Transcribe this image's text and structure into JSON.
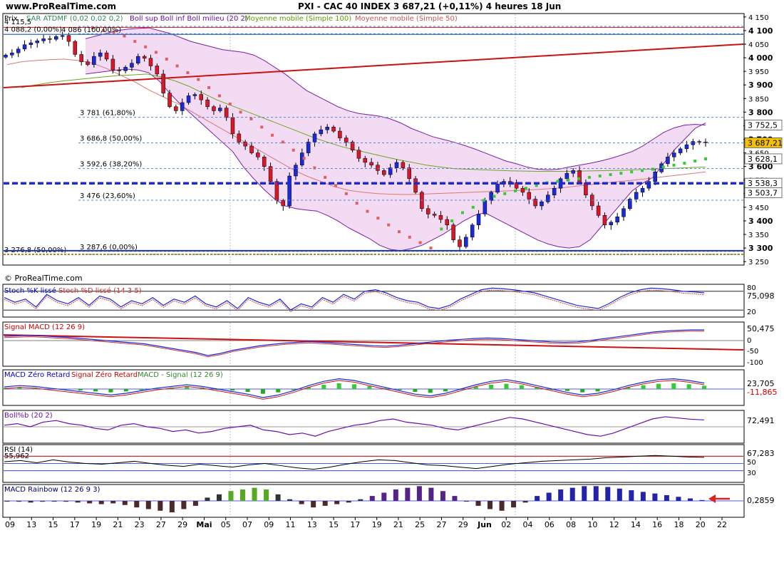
{
  "header": {
    "site": "www.ProRealTime.com",
    "title": "PXI - CAC 40 INDEX    3 687,21 (+0,11%)    4 heures  18 Jun"
  },
  "main": {
    "legend_prix": "Prix",
    "legend_sar": "SAR ATDMF (0,02 0,02 0,2)",
    "legend_boll": "Boll sup Boll inf Boll milieu (20 2)",
    "legend_ma100": "Moyenne mobile (Simple 100)",
    "legend_ma50": "Moyenne mobile (Simple 50)",
    "copyright": "© ProRealTime.com",
    "fib": [
      {
        "label": "4 115,5",
        "value": 4115.5
      },
      {
        "label": "4 088,2 (0,00%)",
        "value": 4088.2
      },
      {
        "label": "4 086 (100,00%)",
        "value": 4086
      },
      {
        "label": "3 781 (61,80%)",
        "value": 3781
      },
      {
        "label": "3 686,8 (50,00%)",
        "value": 3686.8
      },
      {
        "label": "3 592,6 (38,20%)",
        "value": 3592.6
      },
      {
        "label": "3 476 (23,60%)",
        "value": 3476
      },
      {
        "label": "3 287,6 (0,00%)",
        "value": 3287.6
      },
      {
        "label": "3 276,8 (50,00%)",
        "value": 3276.8
      }
    ],
    "yticks": [
      "4 150",
      "4 100",
      "4 050",
      "4 000",
      "3 950",
      "3 900",
      "3 850",
      "3 800",
      "3 750",
      "3 700",
      "3 650",
      "3 600",
      "3 550",
      "3 500",
      "3 450",
      "3 400",
      "3 350",
      "3 300",
      "3 250"
    ],
    "badges": [
      {
        "label": "3 752,5",
        "value": 3752.5,
        "bg": "#ffffff",
        "fg": "#000000"
      },
      {
        "label": "3 687,21",
        "value": 3687.21,
        "bg": "#f4c200",
        "fg": "#000000"
      },
      {
        "label": "3 628,1",
        "value": 3628.1,
        "bg": "#ffffff",
        "fg": "#000000"
      },
      {
        "label": "3 538,3",
        "value": 3538.3,
        "bg": "#ffffff",
        "fg": "#000000"
      },
      {
        "label": "3 503,7",
        "value": 3503.7,
        "bg": "#ffffff",
        "fg": "#000000"
      }
    ]
  },
  "panels": {
    "stoch": {
      "label_k": "Stoch %K lissé",
      "label_d": "Stoch %D lissé (14 3 5)",
      "value": "75,098",
      "ticks": [
        "80",
        "20"
      ]
    },
    "macd": {
      "label": "Signal MACD (12 26 9)",
      "value": "50,475",
      "ticks": [
        "0",
        "-50",
        "-100"
      ]
    },
    "macdzr": {
      "label_a": "MACD Zéro Retard",
      "label_b": "Signal Zéro Retard",
      "label_c": "MACD - Signal (12 26 9)",
      "value": "23,705",
      "value2": "-11,865"
    },
    "bollb": {
      "label": "Boll%b (20 2)",
      "value": "72,491"
    },
    "rsi": {
      "label": "RSI (14)",
      "top_value": "55,962",
      "value": "67,283",
      "ticks": [
        "50",
        "30"
      ]
    },
    "rainbow": {
      "label": "MACD Rainbow (12 26 9 3)",
      "value": "0,2859"
    }
  },
  "chart_data": {
    "type": "candlestick",
    "title": "PXI - CAC 40 INDEX",
    "timeframe": "4 heures",
    "last": 3687.21,
    "change": "+0,11%",
    "ylim": [
      3240,
      4160
    ],
    "x_ticks": [
      "09",
      "13",
      "15",
      "17",
      "19",
      "21",
      "23",
      "27",
      "29",
      "Mai",
      "05",
      "07",
      "09",
      "11",
      "13",
      "15",
      "17",
      "19",
      "21",
      "25",
      "27",
      "29",
      "Jun",
      "02",
      "04",
      "06",
      "08",
      "10",
      "12",
      "14",
      "16",
      "18",
      "20",
      "22"
    ],
    "close": [
      4010,
      4018,
      4032,
      4048,
      4055,
      4062,
      4070,
      4068,
      4078,
      4082,
      4060,
      4012,
      3985,
      3975,
      4005,
      4018,
      3995,
      3955,
      3952,
      3965,
      3980,
      4005,
      3998,
      3970,
      3940,
      3870,
      3820,
      3805,
      3835,
      3860,
      3865,
      3845,
      3820,
      3805,
      3815,
      3780,
      3720,
      3690,
      3675,
      3650,
      3635,
      3600,
      3545,
      3475,
      3455,
      3565,
      3605,
      3650,
      3690,
      3720,
      3735,
      3745,
      3730,
      3705,
      3690,
      3660,
      3630,
      3615,
      3605,
      3585,
      3570,
      3595,
      3615,
      3595,
      3555,
      3505,
      3445,
      3425,
      3420,
      3405,
      3385,
      3330,
      3305,
      3340,
      3385,
      3425,
      3475,
      3505,
      3535,
      3545,
      3540,
      3520,
      3505,
      3480,
      3455,
      3470,
      3495,
      3520,
      3555,
      3575,
      3585,
      3540,
      3495,
      3455,
      3420,
      3385,
      3395,
      3415,
      3445,
      3480,
      3505,
      3520,
      3545,
      3580,
      3610,
      3635,
      3650,
      3665,
      3680,
      3692,
      3690,
      3688
    ],
    "bollinger_upper": [
      4070,
      4080,
      4090,
      4100,
      4105,
      4108,
      4110,
      4100,
      4090,
      4075,
      4060,
      4050,
      4040,
      4030,
      4025,
      4020,
      4010,
      3990,
      3965,
      3940,
      3910,
      3880,
      3860,
      3840,
      3820,
      3805,
      3795,
      3790,
      3785,
      3775,
      3760,
      3740,
      3725,
      3710,
      3700,
      3690,
      3678,
      3665,
      3650,
      3635,
      3620,
      3610,
      3598,
      3590,
      3588,
      3590,
      3598,
      3605,
      3612,
      3620,
      3630,
      3642,
      3655,
      3675,
      3700,
      3725,
      3742,
      3752,
      3755,
      3752
    ],
    "bollinger_lower": [
      3940,
      3945,
      3950,
      3955,
      3958,
      3955,
      3945,
      3915,
      3870,
      3830,
      3795,
      3760,
      3725,
      3690,
      3655,
      3600,
      3555,
      3515,
      3480,
      3455,
      3445,
      3440,
      3436,
      3420,
      3400,
      3375,
      3355,
      3335,
      3310,
      3295,
      3290,
      3298,
      3310,
      3330,
      3350,
      3375,
      3400,
      3420,
      3430,
      3410,
      3390,
      3370,
      3350,
      3330,
      3315,
      3305,
      3300,
      3305,
      3330,
      3375,
      3420,
      3465,
      3510,
      3538,
      3560,
      3610,
      3660,
      3700,
      3740,
      3760
    ],
    "sar": [
      4110,
      4100,
      4095,
      4080,
      4060,
      4040,
      4020,
      3995,
      3970,
      3945,
      3920,
      3890,
      3860,
      3830,
      3800,
      3775,
      3745,
      3715,
      3690,
      3660,
      3630,
      3595,
      3560,
      3530,
      3500,
      3465,
      3435,
      3410,
      3385,
      3360,
      3340,
      3320,
      3300,
      3370,
      3400,
      3430,
      3450,
      3475,
      3490,
      3500,
      3510,
      3520,
      3530,
      3540,
      3545,
      3550,
      3555,
      3560,
      3565,
      3570,
      3575,
      3580,
      3585,
      3590,
      3598,
      3605,
      3612,
      3620,
      3628
    ],
    "ma100": [
      3890,
      3900,
      3908,
      3915,
      3920,
      3925,
      3930,
      3935,
      3937,
      3940,
      3930,
      3915,
      3895,
      3870,
      3845,
      3825,
      3805,
      3785,
      3765,
      3745,
      3725,
      3705,
      3688,
      3672,
      3660,
      3648,
      3636,
      3625,
      3615,
      3605,
      3598,
      3592,
      3590,
      3588,
      3586,
      3584,
      3583,
      3582,
      3582,
      3582,
      3583,
      3584,
      3585,
      3586,
      3588,
      3590,
      3592,
      3594,
      3596,
      3598
    ],
    "ma50": [
      3975,
      3985,
      3990,
      3993,
      3995,
      3990,
      3980,
      3960,
      3935,
      3910,
      3880,
      3855,
      3830,
      3800,
      3770,
      3740,
      3710,
      3680,
      3650,
      3620,
      3590,
      3565,
      3545,
      3525,
      3512,
      3505,
      3500,
      3498,
      3497,
      3498,
      3500,
      3502,
      3504,
      3506,
      3508,
      3510,
      3512,
      3515,
      3518,
      3522,
      3528,
      3534,
      3540,
      3545,
      3550,
      3556,
      3562,
      3568,
      3574,
      3580
    ],
    "stoch_k": [
      60,
      45,
      55,
      30,
      70,
      50,
      40,
      60,
      35,
      65,
      55,
      30,
      50,
      40,
      60,
      35,
      55,
      45,
      65,
      40,
      30,
      50,
      25,
      60,
      45,
      35,
      55,
      20,
      40,
      30,
      60,
      45,
      70,
      55,
      80,
      85,
      75,
      60,
      50,
      45,
      30,
      25,
      35,
      55,
      70,
      85,
      90,
      88,
      85,
      80,
      75,
      65,
      55,
      45,
      35,
      30,
      25,
      40,
      60,
      75,
      85,
      90,
      88,
      85,
      80,
      78,
      75
    ],
    "macd_signal": [
      20,
      22,
      24,
      22,
      18,
      15,
      10,
      5,
      0,
      -5,
      -10,
      -15,
      -25,
      -35,
      -45,
      -55,
      -70,
      -60,
      -45,
      -35,
      -25,
      -18,
      -12,
      -8,
      -5,
      -8,
      -12,
      -16,
      -20,
      -24,
      -26,
      -22,
      -16,
      -10,
      -4,
      2,
      6,
      10,
      12,
      10,
      6,
      2,
      -2,
      -6,
      -8,
      -6,
      0,
      8,
      16,
      24,
      32,
      40,
      45,
      48,
      50,
      50
    ],
    "macd_zero_retard": [
      5,
      8,
      6,
      2,
      -2,
      -6,
      -10,
      -14,
      -10,
      -4,
      2,
      6,
      10,
      6,
      0,
      -6,
      -12,
      -20,
      -14,
      -4,
      8,
      18,
      24,
      20,
      12,
      4,
      -4,
      -12,
      -16,
      -10,
      0,
      10,
      18,
      22,
      16,
      8,
      0,
      -8,
      -14,
      -10,
      -2,
      8,
      16,
      22,
      24,
      20,
      14
    ],
    "boll_b": [
      55,
      60,
      50,
      65,
      70,
      60,
      55,
      45,
      40,
      55,
      60,
      50,
      45,
      35,
      40,
      30,
      35,
      45,
      50,
      55,
      40,
      35,
      25,
      30,
      20,
      35,
      45,
      55,
      60,
      70,
      75,
      65,
      60,
      55,
      45,
      40,
      50,
      60,
      70,
      80,
      75,
      65,
      55,
      45,
      35,
      25,
      20,
      30,
      45,
      60,
      75,
      82,
      78,
      74,
      72
    ],
    "rsi": [
      55,
      58,
      52,
      60,
      54,
      50,
      48,
      52,
      56,
      50,
      45,
      42,
      48,
      44,
      40,
      46,
      50,
      44,
      38,
      34,
      40,
      48,
      55,
      60,
      58,
      52,
      46,
      44,
      40,
      36,
      42,
      48,
      52,
      56,
      58,
      60,
      62,
      66,
      68,
      70,
      72,
      70,
      68,
      67
    ],
    "macd_rainbow": [
      0,
      -1,
      -2,
      -1,
      0,
      -1,
      -2,
      -3,
      -4,
      -3,
      -5,
      -8,
      -10,
      -12,
      -14,
      -10,
      -6,
      4,
      8,
      12,
      14,
      16,
      14,
      8,
      2,
      -4,
      -8,
      -6,
      -4,
      -2,
      2,
      6,
      10,
      14,
      16,
      18,
      16,
      12,
      6,
      0,
      -6,
      -10,
      -12,
      -8,
      -2,
      6,
      10,
      14,
      16,
      18,
      18,
      17,
      15,
      13,
      11,
      9,
      7,
      5,
      3,
      1
    ]
  }
}
